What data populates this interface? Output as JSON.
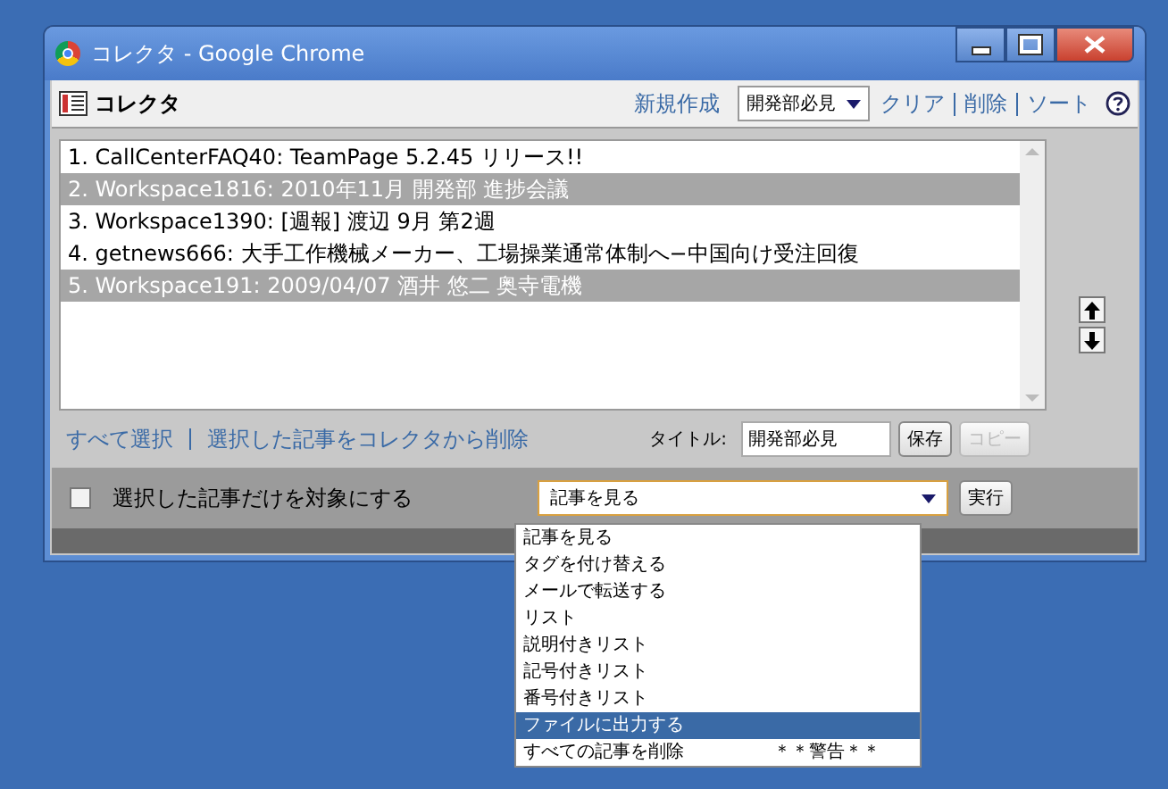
{
  "window": {
    "title": "コレクタ - Google Chrome"
  },
  "toolbar": {
    "title": "コレクタ",
    "new_link": "新規作成",
    "collection": "開発部必見",
    "links": [
      "クリア",
      "削除",
      "ソート"
    ]
  },
  "articles": [
    {
      "text": "1. CallCenterFAQ40: TeamPage 5.2.45 リリース!!",
      "selected": false
    },
    {
      "text": "2. Workspace1816: 2010年11月 開発部 進捗会議",
      "selected": true
    },
    {
      "text": "3. Workspace1390: [週報] 渡辺 9月 第2週",
      "selected": false
    },
    {
      "text": "4. getnews666: 大手工作機械メーカー、工場操業通常体制へ−中国向け受注回復",
      "selected": false
    },
    {
      "text": "5. Workspace191: 2009/04/07 酒井 悠二 奥寺電機",
      "selected": true
    }
  ],
  "footer": {
    "select_all": "すべて選択",
    "remove_selected": "選択した記事をコレクタから削除",
    "title_label": "タイトル:",
    "title_value": "開発部必見",
    "save_button": {
      "label": "保存",
      "disabled": false
    },
    "copy_button": {
      "label": "コピー",
      "disabled": true
    }
  },
  "action_bar": {
    "only_selected": {
      "label": "選択した記事だけを対象にする",
      "checked": false
    },
    "action": "記事を見る",
    "execute": "実行"
  },
  "action_menu": [
    {
      "label": "記事を見る",
      "selected": false
    },
    {
      "label": "タグを付け替える",
      "selected": false
    },
    {
      "label": "メールで転送する",
      "selected": false
    },
    {
      "label": "リスト",
      "selected": false
    },
    {
      "label": "説明付きリスト",
      "selected": false
    },
    {
      "label": "記号付きリスト",
      "selected": false
    },
    {
      "label": "番号付きリスト",
      "selected": false
    },
    {
      "label": "ファイルに出力する",
      "selected": true
    },
    {
      "label": "すべての記事を削除",
      "note": "＊＊警告＊＊",
      "selected": false
    }
  ]
}
